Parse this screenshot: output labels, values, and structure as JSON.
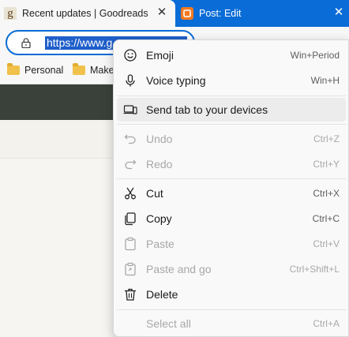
{
  "tabs": [
    {
      "title": "Recent updates | Goodreads",
      "favicon": "g"
    },
    {
      "title": "Post: Edit"
    }
  ],
  "omnibox": {
    "url_visible": "https://www.g"
  },
  "bookmarks": [
    {
      "label": "Personal"
    },
    {
      "label": "Make"
    }
  ],
  "menu": {
    "items": [
      {
        "label": "Emoji",
        "shortcut": "Win+Period",
        "icon": "emoji-icon",
        "enabled": true
      },
      {
        "label": "Voice typing",
        "shortcut": "Win+H",
        "icon": "microphone-icon",
        "enabled": true
      },
      {
        "label": "Send tab to your devices",
        "shortcut": "",
        "icon": "devices-icon",
        "enabled": true
      },
      {
        "label": "Undo",
        "shortcut": "Ctrl+Z",
        "icon": "undo-icon",
        "enabled": false
      },
      {
        "label": "Redo",
        "shortcut": "Ctrl+Y",
        "icon": "redo-icon",
        "enabled": false
      },
      {
        "label": "Cut",
        "shortcut": "Ctrl+X",
        "icon": "scissors-icon",
        "enabled": true
      },
      {
        "label": "Copy",
        "shortcut": "Ctrl+C",
        "icon": "copy-icon",
        "enabled": true
      },
      {
        "label": "Paste",
        "shortcut": "Ctrl+V",
        "icon": "paste-icon",
        "enabled": false
      },
      {
        "label": "Paste and go",
        "shortcut": "Ctrl+Shift+L",
        "icon": "paste-go-icon",
        "enabled": false
      },
      {
        "label": "Delete",
        "shortcut": "",
        "icon": "trash-icon",
        "enabled": true
      },
      {
        "label": "Select all",
        "shortcut": "Ctrl+A",
        "icon": "",
        "enabled": false
      }
    ]
  },
  "colors": {
    "accent": "#0a6cd6",
    "selection": "#1f5fc9",
    "page_dark": "#39413a"
  }
}
